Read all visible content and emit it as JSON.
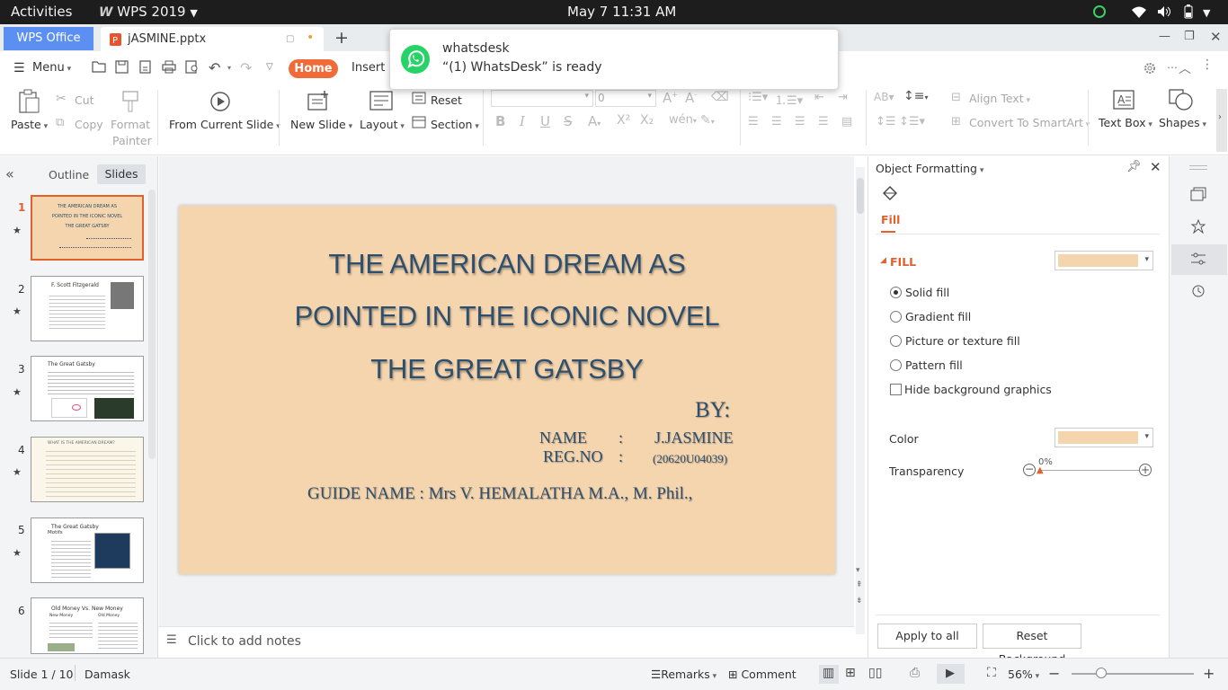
{
  "system_bar": {
    "activities": "Activities",
    "app_menu": "WPS 2019",
    "clock": "May 7  11:31 AM"
  },
  "tabs": {
    "home_tab": "WPS Office",
    "doc_tab": "jASMINE.pptx",
    "add_tab": "+"
  },
  "notification": {
    "app": "whatsdesk",
    "message": "“(1) WhatsDesk” is ready"
  },
  "menubar": {
    "menu": "Menu",
    "home": "Home",
    "insert": "Insert"
  },
  "ribbon": {
    "paste": "Paste",
    "cut": "Cut",
    "copy": "Copy",
    "format_painter_1": "Format",
    "format_painter_2": "Painter",
    "from_current_slide": "From Current Slide",
    "new_slide": "New Slide",
    "layout": "Layout",
    "reset": "Reset",
    "section": "Section",
    "font_size": "0",
    "align_text": "Align Text",
    "convert_smartart": "Convert To SmartArt",
    "text_box": "Text Box",
    "shapes": "Shapes"
  },
  "left_panel": {
    "outline_tab": "Outline",
    "slides_tab": "Slides",
    "thumbs": [
      {
        "num": "1",
        "l1": "THE AMERICAN DREAM AS",
        "l2": "POINTED IN THE ICONIC NOVEL",
        "l3": "THE GREAT GATSBY"
      },
      {
        "num": "2",
        "title": "F. Scott Fitzgerald"
      },
      {
        "num": "3",
        "title": "The Great Gatsby"
      },
      {
        "num": "4",
        "title": "WHAT IS THE AMERICAN DREAM?"
      },
      {
        "num": "5",
        "title": "The Great Gatsby",
        "sub": "Motifs"
      },
      {
        "num": "6",
        "title": "Old Money Vs. New Money",
        "col1": "New Money",
        "col2": "Old Money"
      }
    ]
  },
  "slide": {
    "title_line1": "THE AMERICAN DREAM AS",
    "title_line2": "POINTED IN THE ICONIC NOVEL",
    "title_line3": "THE GREAT GATSBY",
    "by": "BY:",
    "name_label": "NAME",
    "colon1": ":",
    "name_value": "J.JASMINE",
    "reg_label": "REG.NO",
    "colon2": ":",
    "reg_value": "(20620U04039)",
    "guide": "GUIDE NAME :   Mrs V. HEMALATHA M.A., M. Phil.,"
  },
  "notes_placeholder": "Click to add notes",
  "object_formatting": {
    "title": "Object Formatting",
    "fill_tab": "Fill",
    "fill_section": "FILL",
    "options": [
      "Solid fill",
      "Gradient fill",
      "Picture or texture fill",
      "Pattern fill"
    ],
    "selected_option": "Solid fill",
    "hide_bg": "Hide background graphics",
    "color_label": "Color",
    "transparency_label": "Transparency",
    "transparency_value": "0%",
    "apply_all": "Apply to all",
    "reset_bg": "Reset Background",
    "fill_color": "#f5d5ae"
  },
  "status": {
    "slide_count": "Slide 1 / 10",
    "theme": "Damask",
    "remarks": "Remarks",
    "comment": "Comment",
    "zoom": "56%"
  },
  "colors": {
    "accent_orange": "#f16b39",
    "wps_blue": "#5b8ff2",
    "slide_text": "#2e4f6d",
    "slide_bg": "#f5d5ae"
  }
}
